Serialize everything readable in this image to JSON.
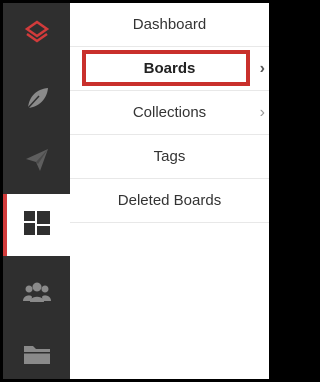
{
  "rail": {
    "items": [
      {
        "icon": "logo-icon"
      },
      {
        "icon": "leaf-icon"
      },
      {
        "icon": "paper-plane-icon"
      },
      {
        "icon": "dashboard-grid-icon",
        "active": true
      },
      {
        "icon": "users-group-icon"
      },
      {
        "icon": "folder-icon"
      }
    ]
  },
  "menu": {
    "items": [
      {
        "label": "Dashboard"
      },
      {
        "label": "Boards",
        "active": true,
        "chevron": "›"
      },
      {
        "label": "Collections",
        "chevron": "›"
      },
      {
        "label": "Tags"
      },
      {
        "label": "Deleted Boards"
      }
    ]
  },
  "colors": {
    "rail_bg": "#2f2f2f",
    "accent": "#d23b3b",
    "highlight_border": "#c9302c"
  }
}
